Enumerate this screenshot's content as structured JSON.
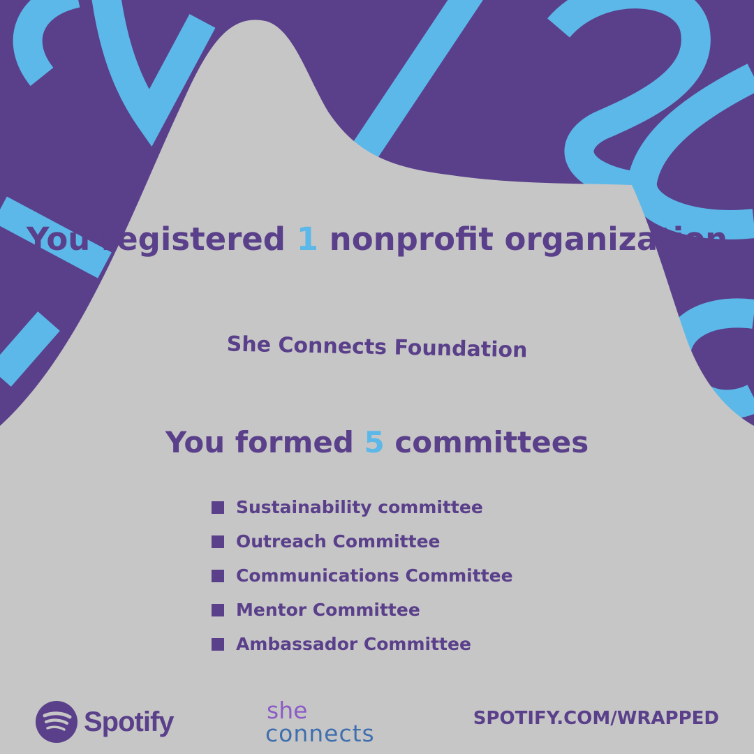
{
  "headline1": {
    "prefix": "You registered ",
    "number": "1",
    "suffix": " nonprofit organization"
  },
  "organization": "She Connects Foundation",
  "headline2": {
    "prefix": "You formed ",
    "number": "5",
    "suffix": " committees"
  },
  "committees": [
    "Sustainability committee",
    "Outreach Committee",
    "Communications Committee",
    "Mentor Committee",
    "Ambassador Committee"
  ],
  "footer": {
    "spotify_logo_text": "Spotify",
    "partner_logo": {
      "line1": "she",
      "line2": "connects"
    },
    "url": "SPOTIFY.COM/WRAPPED"
  },
  "colors": {
    "background_purple": "#5a3f8a",
    "accent_blue": "#5cb8e8",
    "mountain_grey": "#c6c6c6",
    "text_purple": "#5a3f8a"
  },
  "icons": [
    "spotify-logo-icon",
    "square-bullet-icon"
  ]
}
